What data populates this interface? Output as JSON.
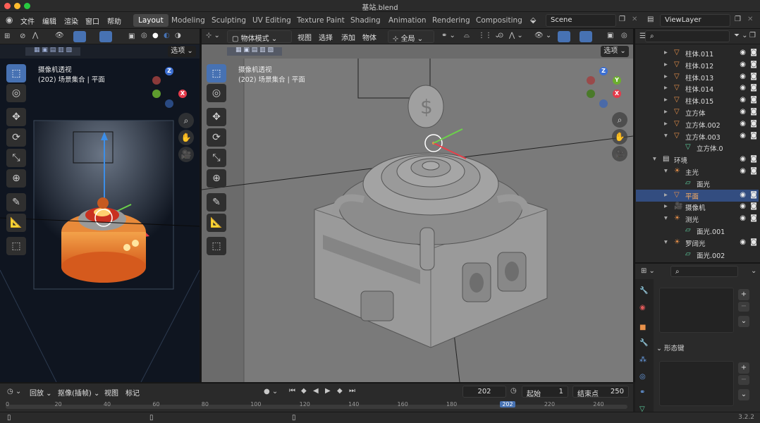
{
  "window": {
    "title": "基站.blend",
    "version": "3.2.2"
  },
  "menu": [
    "文件",
    "编辑",
    "渲染",
    "窗口",
    "帮助"
  ],
  "workspaces": [
    "Layout",
    "Modeling",
    "Sculpting",
    "UV Editing",
    "Texture Paint",
    "Shading",
    "Animation",
    "Rendering",
    "Compositing"
  ],
  "active_workspace": "Layout",
  "scene": "Scene",
  "view_layer": "ViewLayer",
  "left_view": {
    "options": "选项",
    "title": "摄像机透视",
    "subtitle": "(202) 场景集合 | 平面"
  },
  "main_view": {
    "mode": "物体模式",
    "menu": [
      "视图",
      "选择",
      "添加",
      "物体"
    ],
    "orientation": "全局",
    "options": "选项",
    "title": "摄像机透视",
    "subtitle": "(202) 场景集合 | 平面"
  },
  "gizmo": {
    "x": "X",
    "y": "Y",
    "z": "Z"
  },
  "outliner": {
    "rows": [
      {
        "label": "柱体.011",
        "indent": 1
      },
      {
        "label": "柱体.012",
        "indent": 1
      },
      {
        "label": "柱体.013",
        "indent": 1
      },
      {
        "label": "柱体.014",
        "indent": 1
      },
      {
        "label": "柱体.015",
        "indent": 1
      },
      {
        "label": "立方体",
        "indent": 1
      },
      {
        "label": "立方体.002",
        "indent": 1
      },
      {
        "label": "立方体.003",
        "indent": 1
      },
      {
        "label": "立方体.0",
        "indent": 2
      },
      {
        "label": "环境",
        "indent": 0
      },
      {
        "label": "主光",
        "indent": 1
      },
      {
        "label": "面光",
        "indent": 2
      },
      {
        "label": "平面",
        "indent": 1,
        "selected": true
      },
      {
        "label": "摄像机",
        "indent": 1
      },
      {
        "label": "测光",
        "indent": 1
      },
      {
        "label": "面光.001",
        "indent": 2
      },
      {
        "label": "罗阔光",
        "indent": 1
      },
      {
        "label": "面光.002",
        "indent": 2
      }
    ]
  },
  "properties": {
    "shape_keys": "形态键"
  },
  "timeline": {
    "playback": "回放",
    "keying": "抠像(插帧)",
    "view": "视图",
    "marker": "标记",
    "current_frame": "202",
    "start_label": "起始",
    "start": "1",
    "end_label": "结束点",
    "end": "250",
    "ticks": [
      "0",
      "20",
      "40",
      "60",
      "80",
      "100",
      "120",
      "140",
      "160",
      "180",
      "202",
      "220",
      "240"
    ]
  },
  "colors": {
    "accent": "#4772b3",
    "selected_row": "#334d80",
    "orange": "#e8914a"
  }
}
